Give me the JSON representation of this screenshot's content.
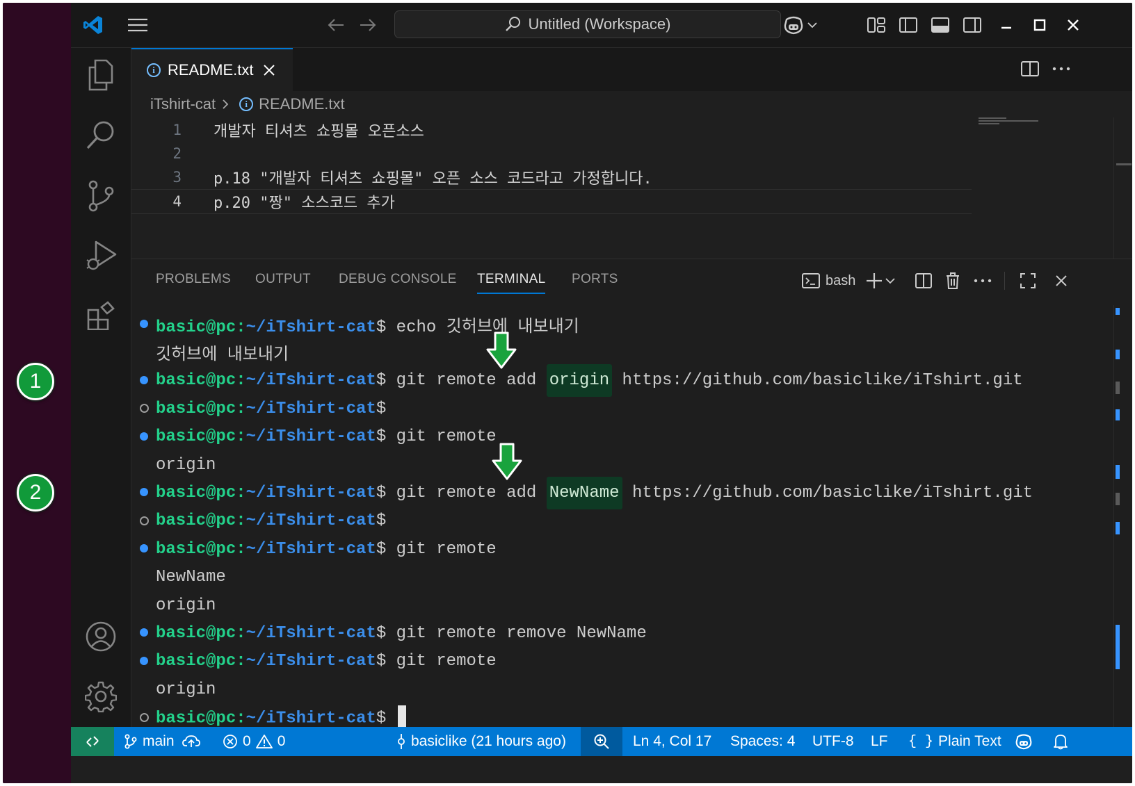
{
  "annotations": {
    "badge1": "1",
    "badge2": "2"
  },
  "titlebar": {
    "search_text": "Untitled (Workspace)"
  },
  "editor": {
    "tab_label": "README.txt",
    "breadcrumb": {
      "folder": "iTshirt-cat",
      "file": "README.txt"
    },
    "lines": [
      {
        "num": "1",
        "text": "개발자 티셔츠 쇼핑몰 오픈소스"
      },
      {
        "num": "2",
        "text": ""
      },
      {
        "num": "3",
        "text": "p.18 \"개발자 티셔츠 쇼핑몰\" 오픈 소스 코드라고 가정합니다."
      },
      {
        "num": "4",
        "text": "p.20 \"짱\" 소스코드 추가"
      }
    ]
  },
  "panel": {
    "tabs": [
      "PROBLEMS",
      "OUTPUT",
      "DEBUG CONSOLE",
      "TERMINAL",
      "PORTS"
    ],
    "active_tab": "TERMINAL",
    "shell_label": "bash"
  },
  "terminal": {
    "prompt_user": "basic@pc",
    "prompt_path": "~/iTshirt-cat",
    "prompt_symbol": "$",
    "lines": [
      {
        "kind": "cmd",
        "dot": "filled",
        "cmd": "echo 깃허브에 내보내기"
      },
      {
        "kind": "out",
        "text": "깃허브에 내보내기"
      },
      {
        "kind": "cmd",
        "dot": "filled",
        "cmd_pre": "git remote add ",
        "cmd_hl": "origin",
        "cmd_post": " https://github.com/basiclike/iTshirt.git"
      },
      {
        "kind": "cmd",
        "dot": "empty",
        "cmd": ""
      },
      {
        "kind": "cmd",
        "dot": "filled",
        "cmd": "git remote"
      },
      {
        "kind": "out",
        "text": "origin"
      },
      {
        "kind": "cmd",
        "dot": "filled",
        "cmd_pre": "git remote add ",
        "cmd_hl": "NewName",
        "cmd_post": " https://github.com/basiclike/iTshirt.git"
      },
      {
        "kind": "cmd",
        "dot": "empty",
        "cmd": ""
      },
      {
        "kind": "cmd",
        "dot": "filled",
        "cmd": "git remote"
      },
      {
        "kind": "out",
        "text": "NewName"
      },
      {
        "kind": "out",
        "text": "origin"
      },
      {
        "kind": "cmd",
        "dot": "filled",
        "cmd": "git remote remove NewName"
      },
      {
        "kind": "cmd",
        "dot": "filled",
        "cmd": "git remote"
      },
      {
        "kind": "out",
        "text": "origin"
      },
      {
        "kind": "cmd",
        "dot": "empty",
        "cmd": ""
      }
    ]
  },
  "statusbar": {
    "branch": "main",
    "errors": "0",
    "warnings": "0",
    "blame": "basiclike (21 hours ago)",
    "position": "Ln 4, Col 17",
    "spaces": "Spaces: 4",
    "encoding": "UTF-8",
    "eol": "LF",
    "language": "Plain Text"
  },
  "colors": {
    "accent": "#0078d4",
    "prompt_user": "#23d18b",
    "prompt_path": "#3b8eea",
    "badge_green": "#119a3a",
    "arrow_green": "#19a33d"
  }
}
